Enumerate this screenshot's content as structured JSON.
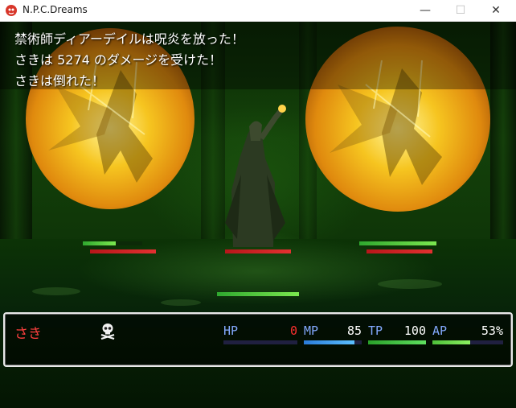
{
  "window": {
    "title": "N.P.C.Dreams",
    "minimize_glyph": "—",
    "maximize_glyph": "☐",
    "close_glyph": "✕"
  },
  "battle_log": {
    "lines": [
      "禁術師ディアーデイルは呪炎を放った！",
      "さきは 5274 のダメージを受けた！",
      "さきは倒れた！"
    ]
  },
  "enemies": [
    {
      "name": "enemy-left",
      "hp_fraction": 0.55,
      "red_fraction": 1.0
    },
    {
      "name": "enemy-center",
      "hp_fraction": 0.0,
      "red_fraction": 1.0
    },
    {
      "name": "enemy-right",
      "hp_fraction": 1.0,
      "red_fraction": 1.0
    }
  ],
  "mage_gauge_fraction": 1.0,
  "party": {
    "actor": {
      "name": "さき",
      "state_icon": "skull-icon",
      "hp": {
        "label": "HP",
        "value": "0",
        "fraction": 0.0
      },
      "mp": {
        "label": "MP",
        "value": "85",
        "fraction": 0.88
      },
      "tp": {
        "label": "TP",
        "value": "100",
        "fraction": 1.0
      },
      "ap": {
        "label": "AP",
        "value": "53%",
        "fraction": 0.53
      }
    }
  },
  "colors": {
    "hp_fill": "#202040",
    "mp_fill": "#3aa0ff",
    "tp_fill": "#3ccf3c",
    "ap_fill": "#6ee04a",
    "actor_name": "#ff4040",
    "label": "#84aaff"
  }
}
